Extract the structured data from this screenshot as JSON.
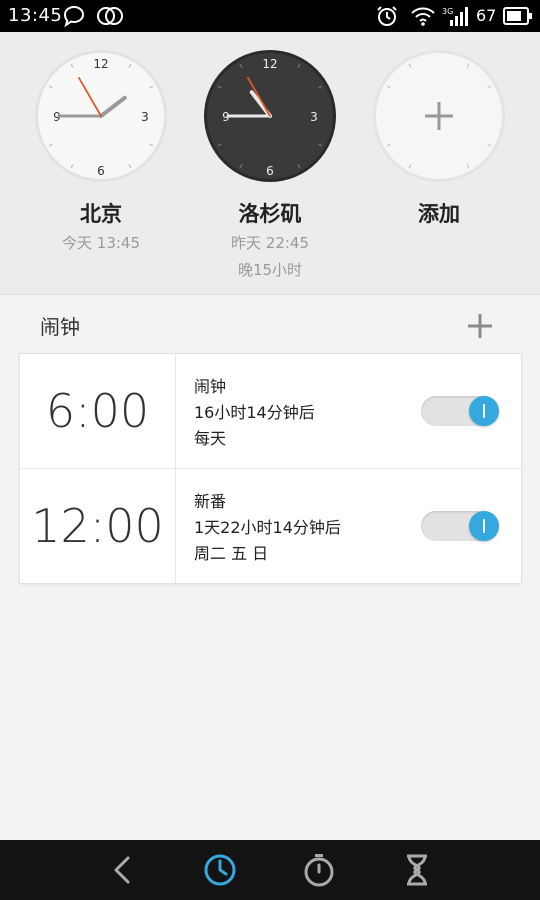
{
  "status_bar": {
    "time": "13:45",
    "battery": "67",
    "icons": [
      "chat-bubble-icon",
      "link-circles-icon",
      "alarm-icon",
      "wifi-icon",
      "signal-3g-icon",
      "battery-icon"
    ]
  },
  "world_clocks": [
    {
      "city": "北京",
      "day": "今天",
      "time": "13:45",
      "offset": "",
      "hour": 13,
      "minute": 45,
      "second": 55,
      "dark": false
    },
    {
      "city": "洛杉矶",
      "day": "昨天",
      "time": "22:45",
      "offset": "晚15小时",
      "hour": 22,
      "minute": 45,
      "second": 55,
      "dark": true
    },
    {
      "city": "添加"
    }
  ],
  "clock_numbers": [
    "12",
    "3",
    "6",
    "9"
  ],
  "alarms_section": {
    "title": "闹钟"
  },
  "alarms": [
    {
      "time": "6:00",
      "label": "闹钟",
      "remaining": "16小时14分钟后",
      "repeat": "每天",
      "enabled": true
    },
    {
      "time": "12:00",
      "label": "新番",
      "remaining": "1天22小时14分钟后",
      "repeat": "周二  五  日",
      "enabled": true
    }
  ],
  "nav": [
    {
      "icon": "back-icon",
      "active": false
    },
    {
      "icon": "clock-tab-icon",
      "active": true
    },
    {
      "icon": "stopwatch-icon",
      "active": false
    },
    {
      "icon": "timer-hourglass-icon",
      "active": false
    }
  ],
  "colors": {
    "accent": "#35a8e0",
    "second_hand": "#e0592b",
    "navbar": "#131313"
  }
}
